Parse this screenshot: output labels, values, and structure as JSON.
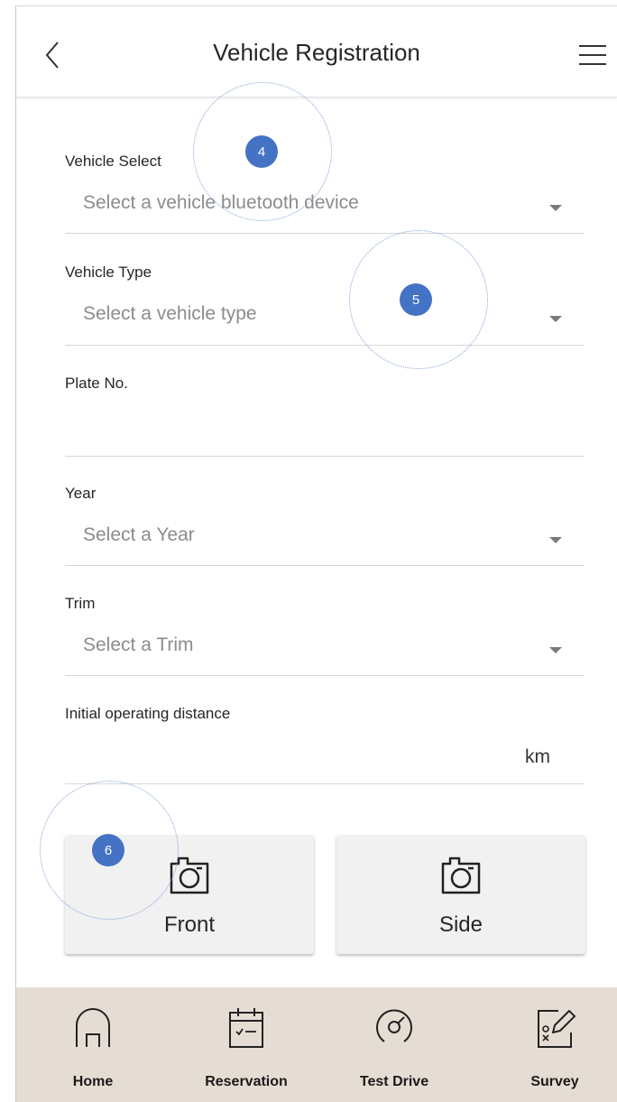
{
  "header": {
    "title": "Vehicle Registration",
    "back_icon": "chevron-left-icon",
    "menu_icon": "hamburger-menu-icon"
  },
  "form": {
    "vehicle_select": {
      "label": "Vehicle Select",
      "placeholder": "Select a vehicle bluetooth device"
    },
    "vehicle_type": {
      "label": "Vehicle Type",
      "placeholder": "Select a vehicle type"
    },
    "plate_no": {
      "label": "Plate No.",
      "value": ""
    },
    "year": {
      "label": "Year",
      "placeholder": "Select a Year"
    },
    "trim": {
      "label": "Trim",
      "placeholder": "Select a Trim"
    },
    "initial_distance": {
      "label": "Initial operating distance",
      "unit": "km",
      "value": ""
    }
  },
  "photo_buttons": [
    {
      "label": "Front",
      "icon": "camera-icon"
    },
    {
      "label": "Side",
      "icon": "camera-icon"
    }
  ],
  "annotations": [
    "4",
    "5",
    "6"
  ],
  "bottom_nav": [
    {
      "label": "Home",
      "icon": "home-icon"
    },
    {
      "label": "Reservation",
      "icon": "calendar-icon"
    },
    {
      "label": "Test Drive",
      "icon": "speedometer-icon"
    },
    {
      "label": "Survey",
      "icon": "survey-icon"
    }
  ],
  "colors": {
    "accent": "#4472c4",
    "nav_background": "#e5dcd3",
    "placeholder_text": "#8c8c8c",
    "divider": "#d7d7d7"
  }
}
